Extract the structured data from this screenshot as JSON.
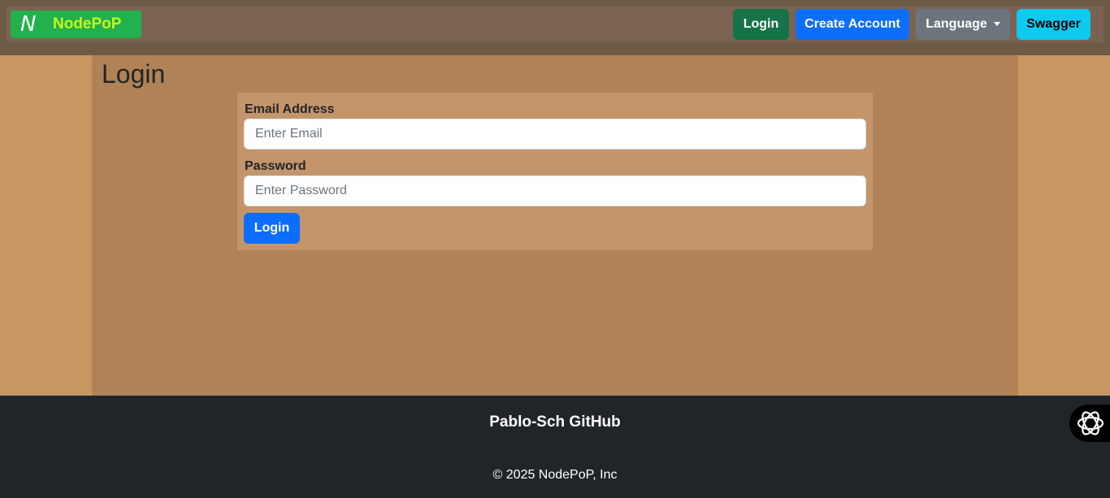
{
  "navbar": {
    "brand_logo": "N",
    "brand_name": "NodePoP",
    "login_label": "Login",
    "create_account_label": "Create Account",
    "language_label": "Language",
    "swagger_label": "Swagger"
  },
  "main": {
    "title": "Login",
    "email": {
      "label": "Email Address",
      "placeholder": "Enter Email",
      "value": ""
    },
    "password": {
      "label": "Password",
      "placeholder": "Enter Password",
      "value": ""
    },
    "submit_label": "Login"
  },
  "footer": {
    "github_link": "Pablo-Sch GitHub",
    "copyright": "© 2025 NodePoP, Inc"
  },
  "colors": {
    "page_bg": "#c99563",
    "main_bg": "#b08256",
    "form_bg": "#c4956a",
    "navbar_bg": "#7c6351",
    "brand_bg": "#22b14c",
    "brand_text": "#c6f51a",
    "success": "#157347",
    "primary": "#0d6efd",
    "secondary": "#6c757d",
    "info": "#0dcaf0",
    "footer_bg": "#212529"
  },
  "icons": {
    "caret": "caret-down-icon",
    "widget": "openai-logo-icon"
  }
}
